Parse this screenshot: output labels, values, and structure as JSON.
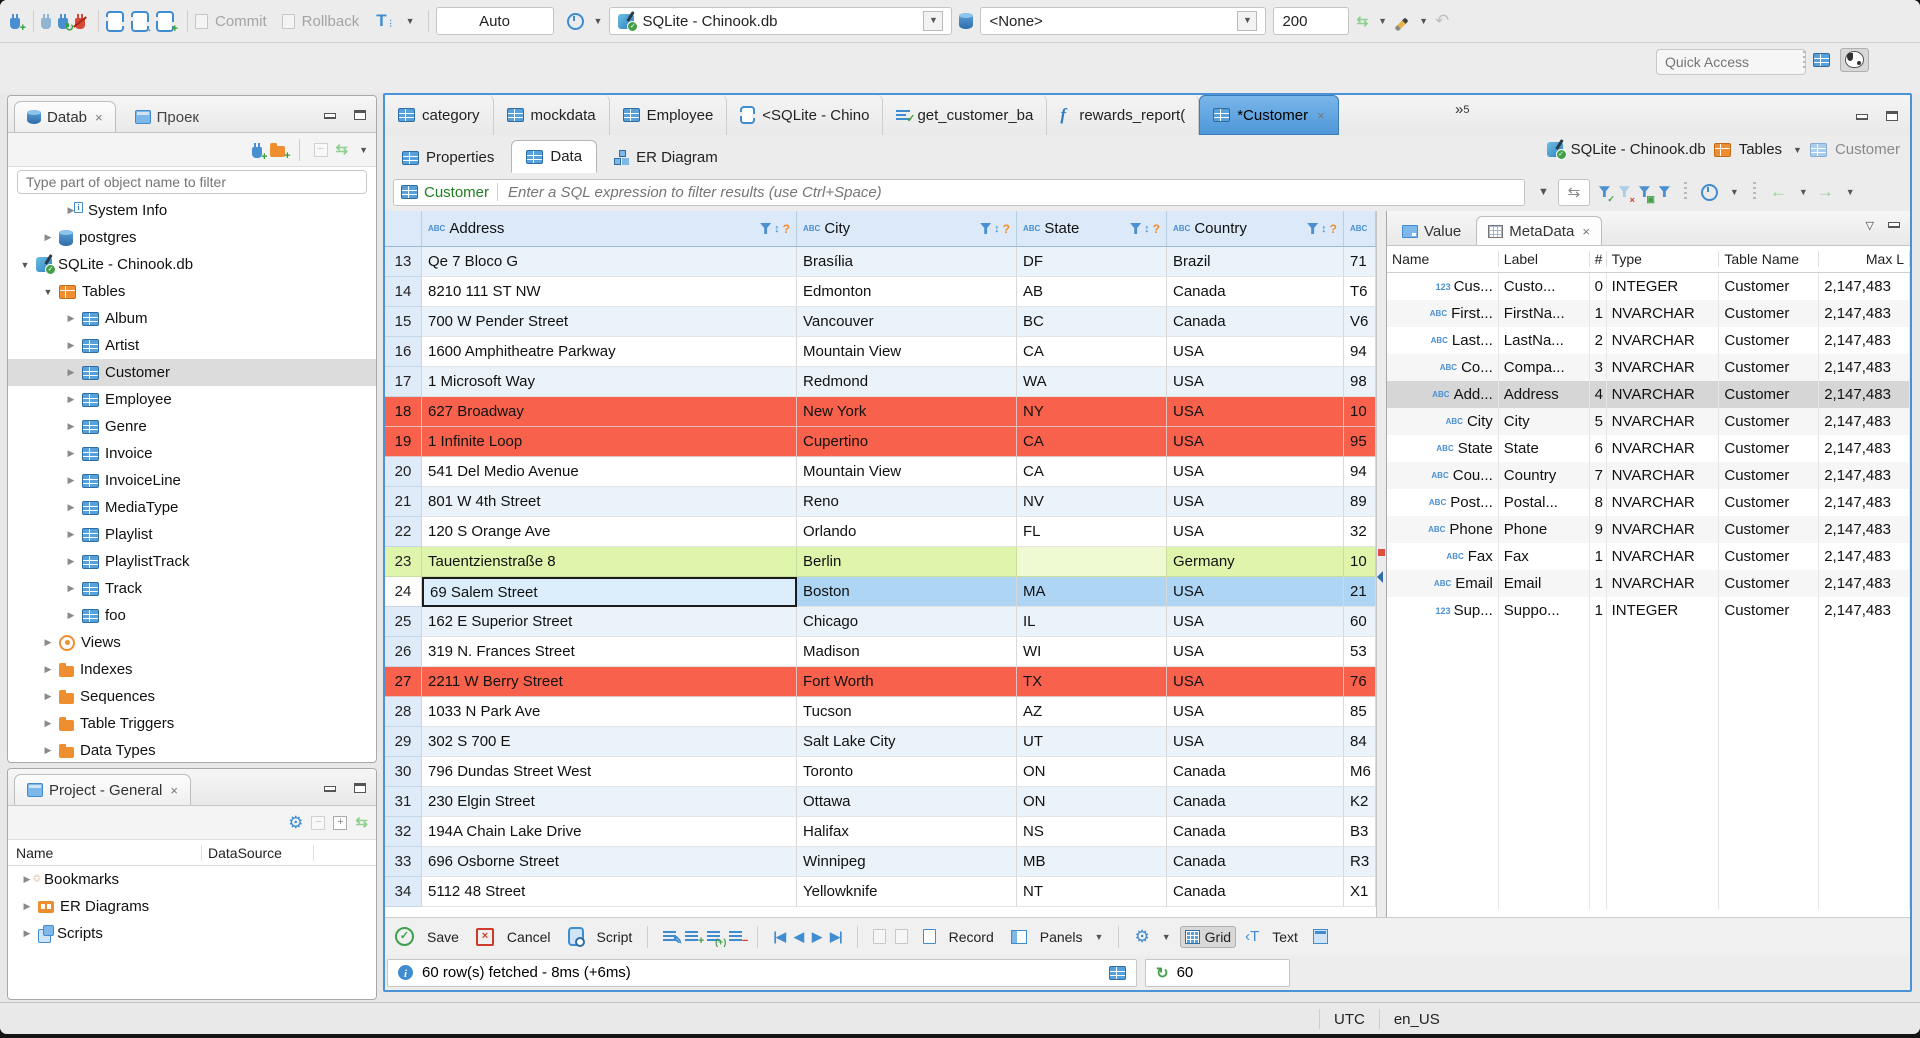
{
  "toolbar": {
    "commit_label": "Commit",
    "rollback_label": "Rollback",
    "auto_value": "Auto",
    "connection_value": "SQLite - Chinook.db",
    "schema_value": "<None>",
    "fetch_size_value": "200",
    "quick_access_placeholder": "Quick Access"
  },
  "navigator": {
    "tab_database": "Datab",
    "tab_project": "Проек",
    "filter_placeholder": "Type part of object name to filter",
    "tree": [
      {
        "label": "System Info",
        "icon": "folder-info",
        "level": 2,
        "arrow": "right"
      },
      {
        "label": "postgres",
        "icon": "db",
        "level": 1,
        "arrow": "right"
      },
      {
        "label": "SQLite - Chinook.db",
        "icon": "sqlite",
        "level": 0,
        "arrow": "down"
      },
      {
        "label": "Tables",
        "icon": "tableor",
        "level": 1,
        "arrow": "down"
      },
      {
        "label": "Album",
        "icon": "table",
        "level": 2,
        "arrow": "right"
      },
      {
        "label": "Artist",
        "icon": "table",
        "level": 2,
        "arrow": "right"
      },
      {
        "label": "Customer",
        "icon": "table",
        "level": 2,
        "arrow": "right",
        "selected": true
      },
      {
        "label": "Employee",
        "icon": "table",
        "level": 2,
        "arrow": "right"
      },
      {
        "label": "Genre",
        "icon": "table",
        "level": 2,
        "arrow": "right"
      },
      {
        "label": "Invoice",
        "icon": "table",
        "level": 2,
        "arrow": "right"
      },
      {
        "label": "InvoiceLine",
        "icon": "table",
        "level": 2,
        "arrow": "right"
      },
      {
        "label": "MediaType",
        "icon": "table",
        "level": 2,
        "arrow": "right"
      },
      {
        "label": "Playlist",
        "icon": "table",
        "level": 2,
        "arrow": "right"
      },
      {
        "label": "PlaylistTrack",
        "icon": "table",
        "level": 2,
        "arrow": "right"
      },
      {
        "label": "Track",
        "icon": "table",
        "level": 2,
        "arrow": "right"
      },
      {
        "label": "foo",
        "icon": "table",
        "level": 2,
        "arrow": "right"
      },
      {
        "label": "Views",
        "icon": "eye",
        "level": 1,
        "arrow": "right"
      },
      {
        "label": "Indexes",
        "icon": "folder",
        "level": 1,
        "arrow": "right"
      },
      {
        "label": "Sequences",
        "icon": "folder",
        "level": 1,
        "arrow": "right"
      },
      {
        "label": "Table Triggers",
        "icon": "folder",
        "level": 1,
        "arrow": "right"
      },
      {
        "label": "Data Types",
        "icon": "folder",
        "level": 1,
        "arrow": "right"
      }
    ]
  },
  "project_panel": {
    "title": "Project - General",
    "columns": [
      "Name",
      "DataSource"
    ],
    "items": [
      {
        "label": "Bookmarks",
        "icon": "folder-star"
      },
      {
        "label": "ER Diagrams",
        "icon": "er"
      },
      {
        "label": "Scripts",
        "icon": "scripts"
      }
    ]
  },
  "editor": {
    "tabs": [
      {
        "label": "category",
        "icon": "table"
      },
      {
        "label": "mockdata",
        "icon": "table"
      },
      {
        "label": "Employee",
        "icon": "table"
      },
      {
        "label": "<SQLite - Chino",
        "icon": "sql"
      },
      {
        "label": "get_customer_ba",
        "icon": "sqlcheck"
      },
      {
        "label": "rewards_report(",
        "icon": "fn"
      },
      {
        "label": "*Customer",
        "icon": "table",
        "active": true,
        "closable": true
      }
    ],
    "overflow_count": "5",
    "subtabs": [
      {
        "label": "Properties"
      },
      {
        "label": "Data"
      },
      {
        "label": "ER Diagram"
      }
    ],
    "breadcrumb": {
      "connection": "SQLite - Chinook.db",
      "container": "Tables",
      "table": "Customer"
    }
  },
  "filter_bar": {
    "table": "Customer",
    "placeholder": "Enter a SQL expression to filter results (use Ctrl+Space)"
  },
  "grid": {
    "columns": [
      "Address",
      "City",
      "State",
      "Country"
    ],
    "rows": [
      {
        "num": "13",
        "address": "Qe 7 Bloco G",
        "city": "Brasília",
        "state": "DF",
        "country": "Brazil",
        "postal": "71",
        "style": "odd"
      },
      {
        "num": "14",
        "address": "8210 111 ST NW",
        "city": "Edmonton",
        "state": "AB",
        "country": "Canada",
        "postal": "T6",
        "style": "even"
      },
      {
        "num": "15",
        "address": "700 W Pender Street",
        "city": "Vancouver",
        "state": "BC",
        "country": "Canada",
        "postal": "V6",
        "style": "odd"
      },
      {
        "num": "16",
        "address": "1600 Amphitheatre Parkway",
        "city": "Mountain View",
        "state": "CA",
        "country": "USA",
        "postal": "94",
        "style": "even"
      },
      {
        "num": "17",
        "address": "1 Microsoft Way",
        "city": "Redmond",
        "state": "WA",
        "country": "USA",
        "postal": "98",
        "style": "odd"
      },
      {
        "num": "18",
        "address": "627 Broadway",
        "city": "New York",
        "state": "NY",
        "country": "USA",
        "postal": "10",
        "style": "deleted"
      },
      {
        "num": "19",
        "address": "1 Infinite Loop",
        "city": "Cupertino",
        "state": "CA",
        "country": "USA",
        "postal": "95",
        "style": "deleted"
      },
      {
        "num": "20",
        "address": "541 Del Medio Avenue",
        "city": "Mountain View",
        "state": "CA",
        "country": "USA",
        "postal": "94",
        "style": "even"
      },
      {
        "num": "21",
        "address": "801 W 4th Street",
        "city": "Reno",
        "state": "NV",
        "country": "USA",
        "postal": "89",
        "style": "odd"
      },
      {
        "num": "22",
        "address": "120 S Orange Ave",
        "city": "Orlando",
        "state": "FL",
        "country": "USA",
        "postal": "32",
        "style": "even"
      },
      {
        "num": "23",
        "address": "Tauentzienstraße 8",
        "city": "Berlin",
        "state": "",
        "country": "Germany",
        "postal": "10",
        "style": "new"
      },
      {
        "num": "24",
        "address": "69 Salem Street",
        "city": "Boston",
        "state": "MA",
        "country": "USA",
        "postal": "21",
        "style": "selected"
      },
      {
        "num": "25",
        "address": "162 E Superior Street",
        "city": "Chicago",
        "state": "IL",
        "country": "USA",
        "postal": "60",
        "style": "odd"
      },
      {
        "num": "26",
        "address": "319 N. Frances Street",
        "city": "Madison",
        "state": "WI",
        "country": "USA",
        "postal": "53",
        "style": "even"
      },
      {
        "num": "27",
        "address": "2211 W Berry Street",
        "city": "Fort Worth",
        "state": "TX",
        "country": "USA",
        "postal": "76",
        "style": "deleted"
      },
      {
        "num": "28",
        "address": "1033 N Park Ave",
        "city": "Tucson",
        "state": "AZ",
        "country": "USA",
        "postal": "85",
        "style": "even"
      },
      {
        "num": "29",
        "address": "302 S 700 E",
        "city": "Salt Lake City",
        "state": "UT",
        "country": "USA",
        "postal": "84",
        "style": "odd"
      },
      {
        "num": "30",
        "address": "796 Dundas Street West",
        "city": "Toronto",
        "state": "ON",
        "country": "Canada",
        "postal": "M6",
        "style": "even"
      },
      {
        "num": "31",
        "address": "230 Elgin Street",
        "city": "Ottawa",
        "state": "ON",
        "country": "Canada",
        "postal": "K2",
        "style": "odd"
      },
      {
        "num": "32",
        "address": "194A Chain Lake Drive",
        "city": "Halifax",
        "state": "NS",
        "country": "Canada",
        "postal": "B3",
        "style": "even"
      },
      {
        "num": "33",
        "address": "696 Osborne Street",
        "city": "Winnipeg",
        "state": "MB",
        "country": "Canada",
        "postal": "R3",
        "style": "odd"
      },
      {
        "num": "34",
        "address": "5112 48 Street",
        "city": "Yellowknife",
        "state": "NT",
        "country": "Canada",
        "postal": "X1",
        "style": "even"
      }
    ]
  },
  "metadata": {
    "tab_value": "Value",
    "tab_metadata": "MetaData",
    "columns": [
      "Name",
      "Label",
      "#",
      "Type",
      "Table Name",
      "Max L"
    ],
    "rows": [
      {
        "kind": "123",
        "name": "Cus...",
        "label": "Custo...",
        "num": "0",
        "type": "INTEGER",
        "table": "Customer",
        "max": "2,147,483"
      },
      {
        "kind": "abc",
        "name": "First...",
        "label": "FirstNa...",
        "num": "1",
        "type": "NVARCHAR",
        "table": "Customer",
        "max": "2,147,483"
      },
      {
        "kind": "abc",
        "name": "Last...",
        "label": "LastNa...",
        "num": "2",
        "type": "NVARCHAR",
        "table": "Customer",
        "max": "2,147,483"
      },
      {
        "kind": "abc",
        "name": "Co...",
        "label": "Compa...",
        "num": "3",
        "type": "NVARCHAR",
        "table": "Customer",
        "max": "2,147,483"
      },
      {
        "kind": "abc",
        "name": "Add...",
        "label": "Address",
        "num": "4",
        "type": "NVARCHAR",
        "table": "Customer",
        "max": "2,147,483",
        "selected": true
      },
      {
        "kind": "abc",
        "name": "City",
        "label": "City",
        "num": "5",
        "type": "NVARCHAR",
        "table": "Customer",
        "max": "2,147,483"
      },
      {
        "kind": "abc",
        "name": "State",
        "label": "State",
        "num": "6",
        "type": "NVARCHAR",
        "table": "Customer",
        "max": "2,147,483"
      },
      {
        "kind": "abc",
        "name": "Cou...",
        "label": "Country",
        "num": "7",
        "type": "NVARCHAR",
        "table": "Customer",
        "max": "2,147,483"
      },
      {
        "kind": "abc",
        "name": "Post...",
        "label": "Postal...",
        "num": "8",
        "type": "NVARCHAR",
        "table": "Customer",
        "max": "2,147,483"
      },
      {
        "kind": "abc",
        "name": "Phone",
        "label": "Phone",
        "num": "9",
        "type": "NVARCHAR",
        "table": "Customer",
        "max": "2,147,483"
      },
      {
        "kind": "abc",
        "name": "Fax",
        "label": "Fax",
        "num": "1",
        "type": "NVARCHAR",
        "table": "Customer",
        "max": "2,147,483"
      },
      {
        "kind": "abc",
        "name": "Email",
        "label": "Email",
        "num": "1",
        "type": "NVARCHAR",
        "table": "Customer",
        "max": "2,147,483"
      },
      {
        "kind": "123",
        "name": "Sup...",
        "label": "Suppo...",
        "num": "1",
        "type": "INTEGER",
        "table": "Customer",
        "max": "2,147,483"
      }
    ]
  },
  "result_toolbar": {
    "save": "Save",
    "cancel": "Cancel",
    "script": "Script",
    "record": "Record",
    "panels": "Panels",
    "grid": "Grid",
    "text": "Text"
  },
  "status": {
    "message": "60 row(s) fetched - 8ms (+6ms)",
    "refresh_count": "60"
  },
  "statusbar": {
    "timezone": "UTC",
    "locale": "en_US"
  }
}
